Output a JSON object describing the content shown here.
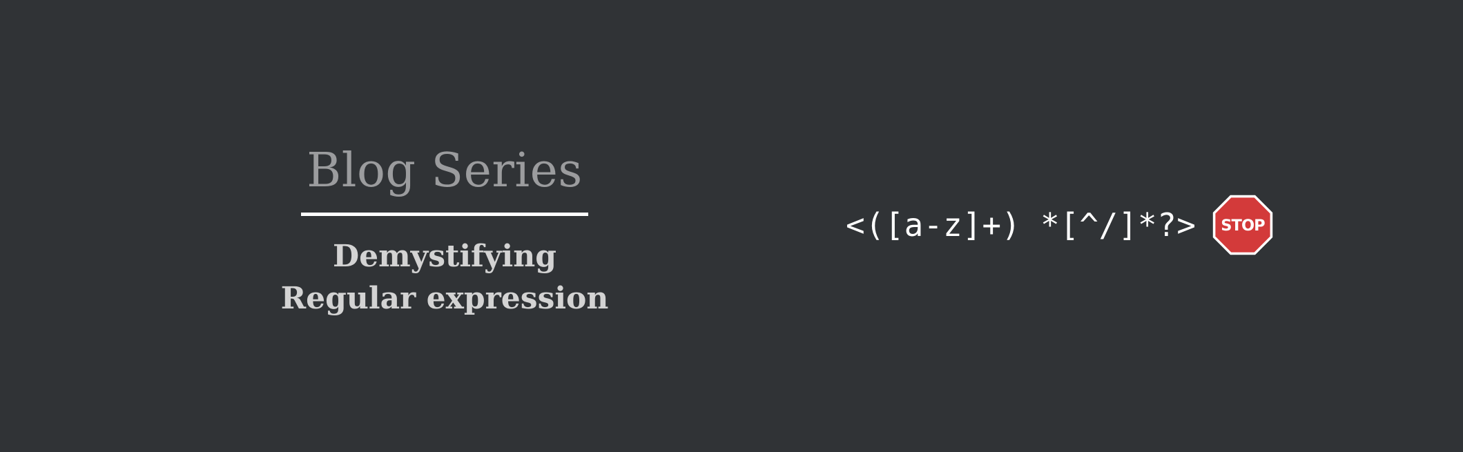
{
  "banner": {
    "title": "Blog Series",
    "subtitle_line1": "Demystifying",
    "subtitle_line2": "Regular expression",
    "regex": "<([a-z]+) *[^/]*?>",
    "stop_sign": {
      "icon": "stop-sign-icon",
      "label": "STOP",
      "color": "#d33a3a"
    },
    "colors": {
      "background": "#303336",
      "title": "#9b9c9e",
      "subtitle": "#d3d3d3",
      "divider": "#ffffff",
      "regex": "#ffffff"
    }
  }
}
